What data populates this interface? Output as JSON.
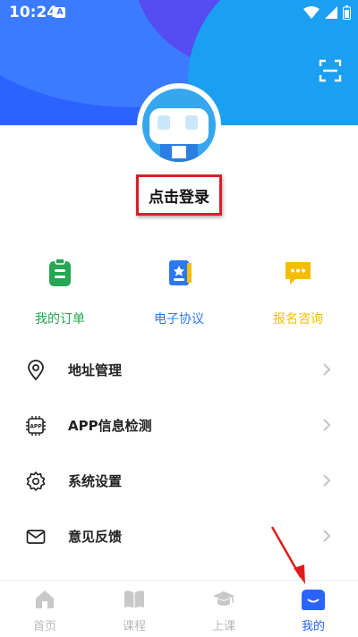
{
  "status": {
    "time": "10:24",
    "badge": "A"
  },
  "profile": {
    "login_label": "点击登录"
  },
  "shortcuts": [
    {
      "label": "我的订单",
      "color": "#27a653",
      "icon": "clipboard-icon"
    },
    {
      "label": "电子协议",
      "color": "#2c78f0",
      "icon": "contract-icon"
    },
    {
      "label": "报名咨询",
      "color": "#f5bd00",
      "icon": "chat-icon"
    }
  ],
  "menu": [
    {
      "label": "地址管理",
      "icon": "location-icon"
    },
    {
      "label": "APP信息检测",
      "icon": "chip-icon"
    },
    {
      "label": "系统设置",
      "icon": "gear-icon"
    },
    {
      "label": "意见反馈",
      "icon": "mail-icon"
    }
  ],
  "tabs": [
    {
      "label": "首页",
      "icon": "home-icon"
    },
    {
      "label": "课程",
      "icon": "book-icon"
    },
    {
      "label": "上课",
      "icon": "graduation-cap-icon"
    },
    {
      "label": "我的",
      "icon": "profile-icon",
      "active": true
    }
  ],
  "colors": {
    "accent": "#2a63ff",
    "highlight_box": "#d81f26"
  }
}
